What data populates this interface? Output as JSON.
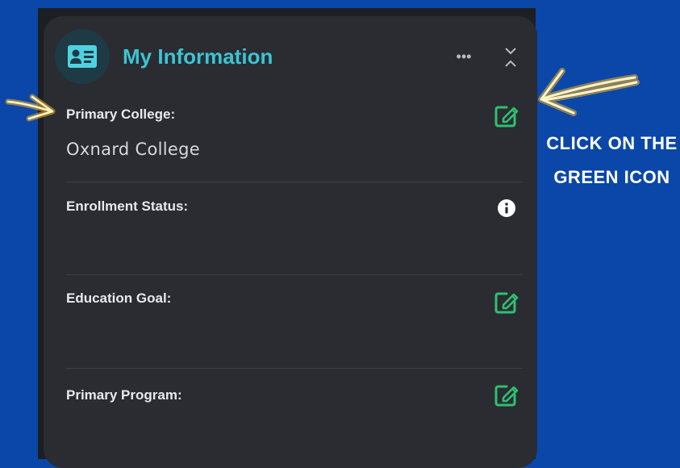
{
  "card": {
    "title": "My Information",
    "more_label": "•••",
    "header_icon": "id-card-icon",
    "collapse_icon": "collapse-chevrons-icon"
  },
  "fields": [
    {
      "label": "Primary College:",
      "value": "Oxnard College",
      "action_icon": "edit-icon"
    },
    {
      "label": "Enrollment Status:",
      "value": "",
      "action_icon": "info-icon"
    },
    {
      "label": "Education Goal:",
      "value": "",
      "action_icon": "edit-icon"
    },
    {
      "label": "Primary Program:",
      "value": "",
      "action_icon": "edit-icon"
    }
  ],
  "annotation": {
    "line1": "CLICK ON THE",
    "line2": "GREEN ICON",
    "arrow_icon": "hand-drawn-arrow-icon"
  },
  "colors": {
    "background": "#0a47a8",
    "card": "#2a2c31",
    "title": "#3ec3d3",
    "edit_icon": "#2fbf71",
    "arrow_glow": "#f7b21c"
  }
}
